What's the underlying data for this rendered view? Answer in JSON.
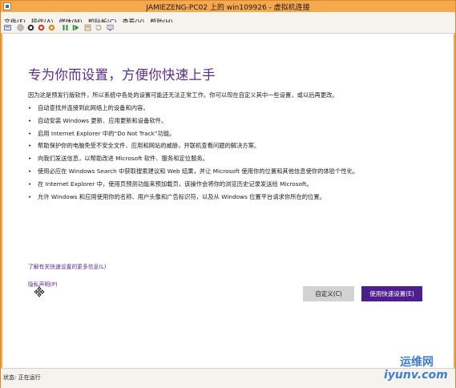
{
  "window": {
    "title": "JAMIEZENG-PC02 上的 win109926 - 虚拟机连接"
  },
  "menu": [
    {
      "label": "文件(F)"
    },
    {
      "label": "操作(A)"
    },
    {
      "label": "媒体(M)"
    },
    {
      "label": "剪贴板(C)"
    },
    {
      "label": "查看(V)"
    },
    {
      "label": "帮助(H)"
    }
  ],
  "toolbar": {
    "icons": [
      "ctrl-alt-del-icon",
      "start-icon",
      "turn-off-icon",
      "shutdown-icon",
      "save-icon",
      "pause-icon",
      "reset-icon",
      "checkpoint-icon",
      "revert-icon",
      "enhanced-session-icon"
    ]
  },
  "setup": {
    "heading": "专为你而设置，方便你快速上手",
    "intro": "因为这是预发行版软件，所以系统中各处的设置可能还无法正常工作。你可以现在自定义其中一些设置，或以后再更改。",
    "bullets": [
      "自动查找并连接到此网络上的设备和内容。",
      "自动安装 Windows 更新、应用更新和设备软件。",
      "启用 Internet Explorer 中的“Do Not Track”功能。",
      "帮助保护你的电脑免受不安全文件、应用和网站的威胁，并联机查看问题的解决方案。",
      "向我们发送信息，以帮助改进 Microsoft 软件、服务和定位服务。",
      "使用必应在 Windows Search 中获取搜索建议和 Web 结果，并让 Microsoft 使用你的位置和其他信息使你的体验个性化。",
      "在 Internet Explorer 中，使用页预测功能来预加载页，该操作会将你的浏览历史记录发送给 Microsoft。",
      "允许 Windows 和应用使用你的名称、用户头像和广告标识符，以及从 Windows 位置平台请求你所在的位置。"
    ],
    "learn_more_link": "了解有关快速设置的更多信息(L)",
    "privacy_link": "隐私声明(P)",
    "customize_button": "自定义(C)",
    "express_button": "使用快速设置(E)"
  },
  "status": {
    "text": "状态: 正在运行"
  },
  "watermark": {
    "line1": "运维网",
    "line2": "iyunv.com"
  },
  "colors": {
    "accent_purple": "#4c1f8c",
    "heading_purple": "#5b2c8c",
    "frame_orange": "#f6a84d"
  }
}
